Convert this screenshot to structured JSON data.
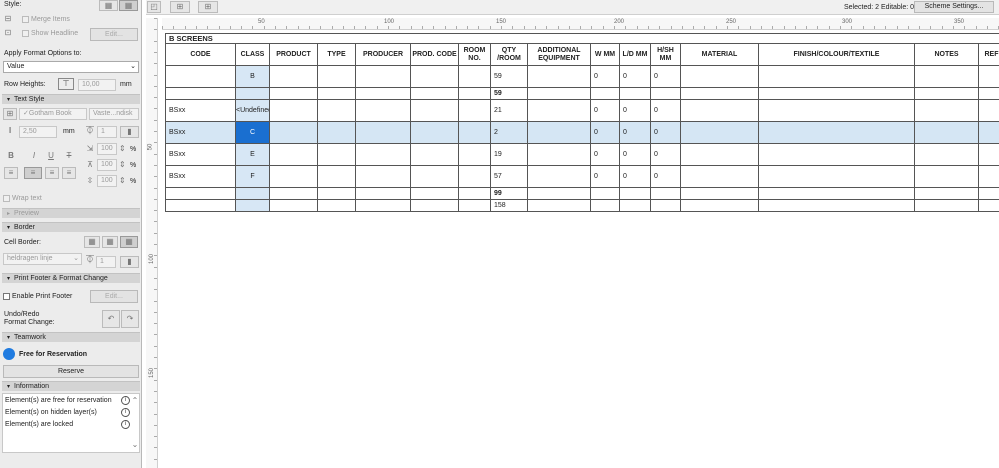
{
  "panel": {
    "style_label": "Style:",
    "merge_items": "Merge Items",
    "show_headline": "Show Headline",
    "edit_label": "Edit...",
    "apply_format_label": "Apply Format Options to:",
    "apply_format_value": "Value",
    "row_heights_label": "Row Heights:",
    "row_height_value": "10,00",
    "unit_mm": "mm",
    "text_style_header": "Text Style",
    "font_value": "Gotham Book",
    "script_value": "Vaste...ndisk",
    "font_size_value": "2,50",
    "pen_value": "1",
    "pct_values": [
      "100",
      "100",
      "100"
    ],
    "pct_symbol": "%",
    "wrap_text": "Wrap text",
    "preview_header": "Preview",
    "border_header": "Border",
    "cell_border_label": "Cell Border:",
    "border_line_value": "heldragen linje",
    "border_pen_value": "1",
    "print_footer_header": "Print Footer & Format Change",
    "enable_print_footer": "Enable Print Footer",
    "undo_redo_label": "Undo/Redo",
    "format_change_label": "Format Change:",
    "teamwork_header": "Teamwork",
    "free_for_reservation": "Free for Reservation",
    "reserve_button": "Reserve",
    "information_header": "Information",
    "info_items": [
      "Element(s) are free for reservation",
      "Element(s) on hidden layer(s)",
      "Element(s) are locked"
    ]
  },
  "toolbar": {
    "selected_text": "Selected: 2  Editable: 0",
    "scheme_settings": "Scheme Settings..."
  },
  "ruler": {
    "h_labels": [
      "0",
      "50",
      "100",
      "150",
      "200",
      "250",
      "300",
      "350"
    ],
    "v_labels": [
      "50",
      "100",
      "150"
    ]
  },
  "schedule": {
    "title": "B SCREENS",
    "headers": [
      "CODE",
      "CLASS",
      "PRODUCT",
      "TYPE",
      "PRODUCER",
      "PROD. CODE",
      "ROOM NO.",
      "QTY /ROOM",
      "ADDITIONAL EQUIPMENT",
      "W MM",
      "L/D MM",
      "H/SH MM",
      "MATERIAL",
      "FINISH/COLOUR/TEXTILE",
      "NOTES",
      "REF"
    ],
    "rows": [
      {
        "code": "",
        "class": "B",
        "qty": "59",
        "w": "0",
        "ld": "0",
        "hsh": "0"
      },
      {
        "code": "",
        "class": "",
        "qty": "59",
        "w": "",
        "ld": "",
        "hsh": ""
      },
      {
        "code": "BSxx",
        "class": "<Undefined>",
        "qty": "21",
        "w": "0",
        "ld": "0",
        "hsh": "0"
      },
      {
        "code": "BSxx",
        "class": "C",
        "qty": "2",
        "w": "0",
        "ld": "0",
        "hsh": "0"
      },
      {
        "code": "BSxx",
        "class": "E",
        "qty": "19",
        "w": "0",
        "ld": "0",
        "hsh": "0"
      },
      {
        "code": "BSxx",
        "class": "F",
        "qty": "57",
        "w": "0",
        "ld": "0",
        "hsh": "0"
      },
      {
        "code": "",
        "class": "",
        "qty": "99",
        "w": "",
        "ld": "",
        "hsh": ""
      },
      {
        "code": "",
        "class": "",
        "qty": "158",
        "w": "",
        "ld": "",
        "hsh": ""
      }
    ]
  }
}
